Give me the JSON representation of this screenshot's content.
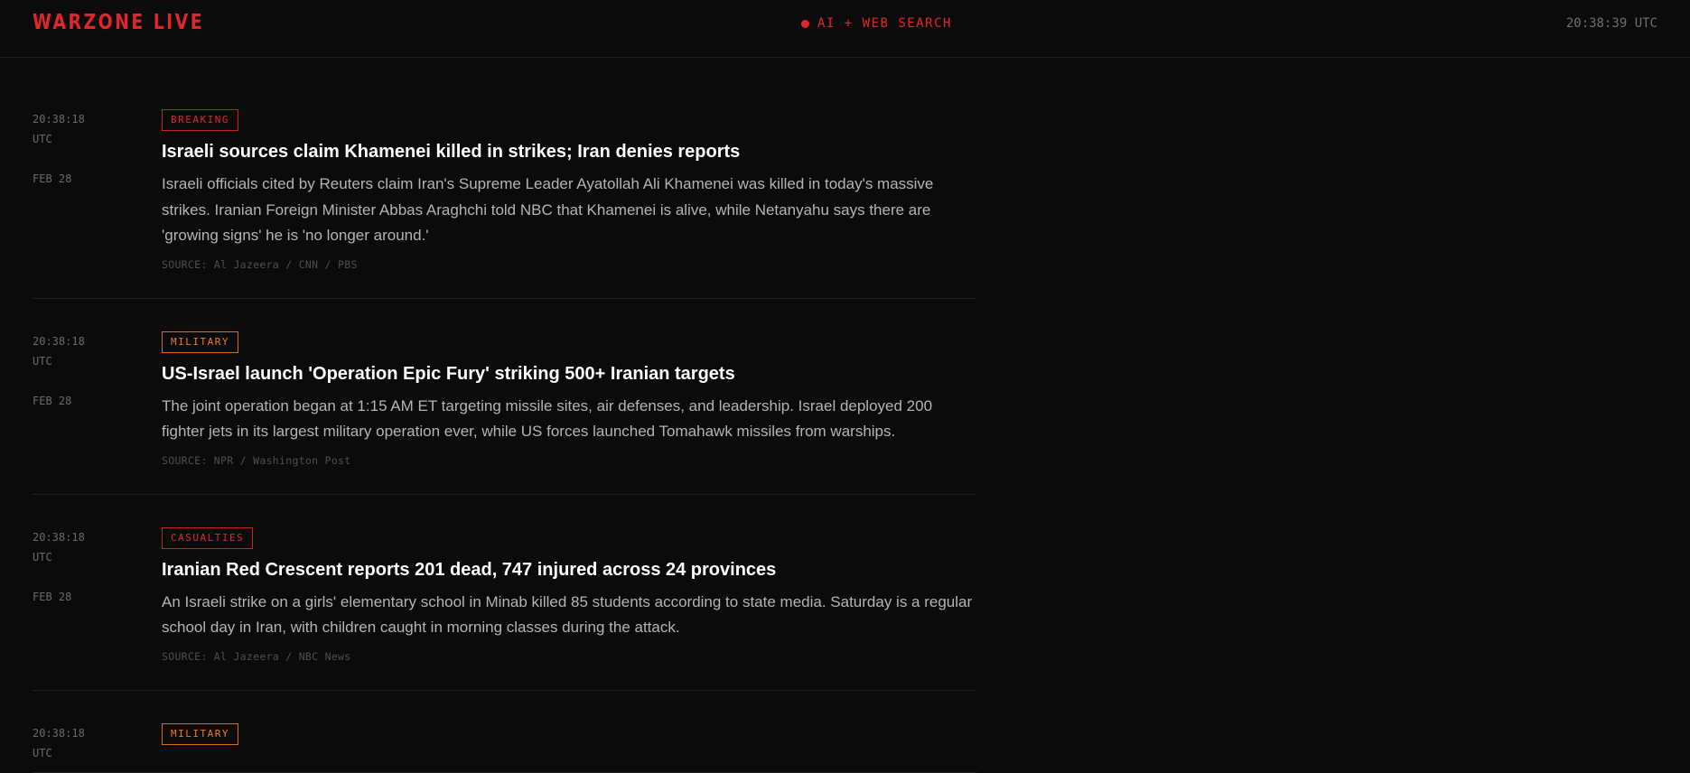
{
  "header": {
    "brand": "WARZONE LIVE",
    "status": "AI + WEB SEARCH",
    "clock": "20:38:39 UTC",
    "colors": {
      "accent": "#e0262b",
      "background": "#0b0b0b"
    }
  },
  "feed": [
    {
      "time": "20:38:18",
      "tz": "UTC",
      "date": "FEB 28",
      "tag": "BREAKING",
      "tag_color": "#e0262b",
      "headline": "Israeli sources claim Khamenei killed in strikes; Iran denies reports",
      "summary": "Israeli officials cited by Reuters claim Iran's Supreme Leader Ayatollah Ali Khamenei was killed in today's massive strikes. Iranian Foreign Minister Abbas Araghchi told NBC that Khamenei is alive, while Netanyahu says there are 'growing signs' he is 'no longer around.'",
      "source": "SOURCE: Al Jazeera / CNN / PBS"
    },
    {
      "time": "20:38:18",
      "tz": "UTC",
      "date": "FEB 28",
      "tag": "MILITARY",
      "tag_color": "#f07a1c",
      "headline": "US-Israel launch 'Operation Epic Fury' striking 500+ Iranian targets",
      "summary": "The joint operation began at 1:15 AM ET targeting missile sites, air defenses, and leadership. Israel deployed 200 fighter jets in its largest military operation ever, while US forces launched Tomahawk missiles from warships.",
      "source": "SOURCE: NPR / Washington Post"
    },
    {
      "time": "20:38:18",
      "tz": "UTC",
      "date": "FEB 28",
      "tag": "CASUALTIES",
      "tag_color": "#e0262b",
      "headline": "Iranian Red Crescent reports 201 dead, 747 injured across 24 provinces",
      "summary": "An Israeli strike on a girls' elementary school in Minab killed 85 students according to state media. Saturday is a regular school day in Iran, with children caught in morning classes during the attack.",
      "source": "SOURCE: Al Jazeera / NBC News"
    },
    {
      "time": "20:38:18",
      "tz": "UTC",
      "date": "",
      "tag": "MILITARY",
      "tag_color": "#f07a1c",
      "headline": "",
      "summary": "",
      "source": ""
    }
  ]
}
